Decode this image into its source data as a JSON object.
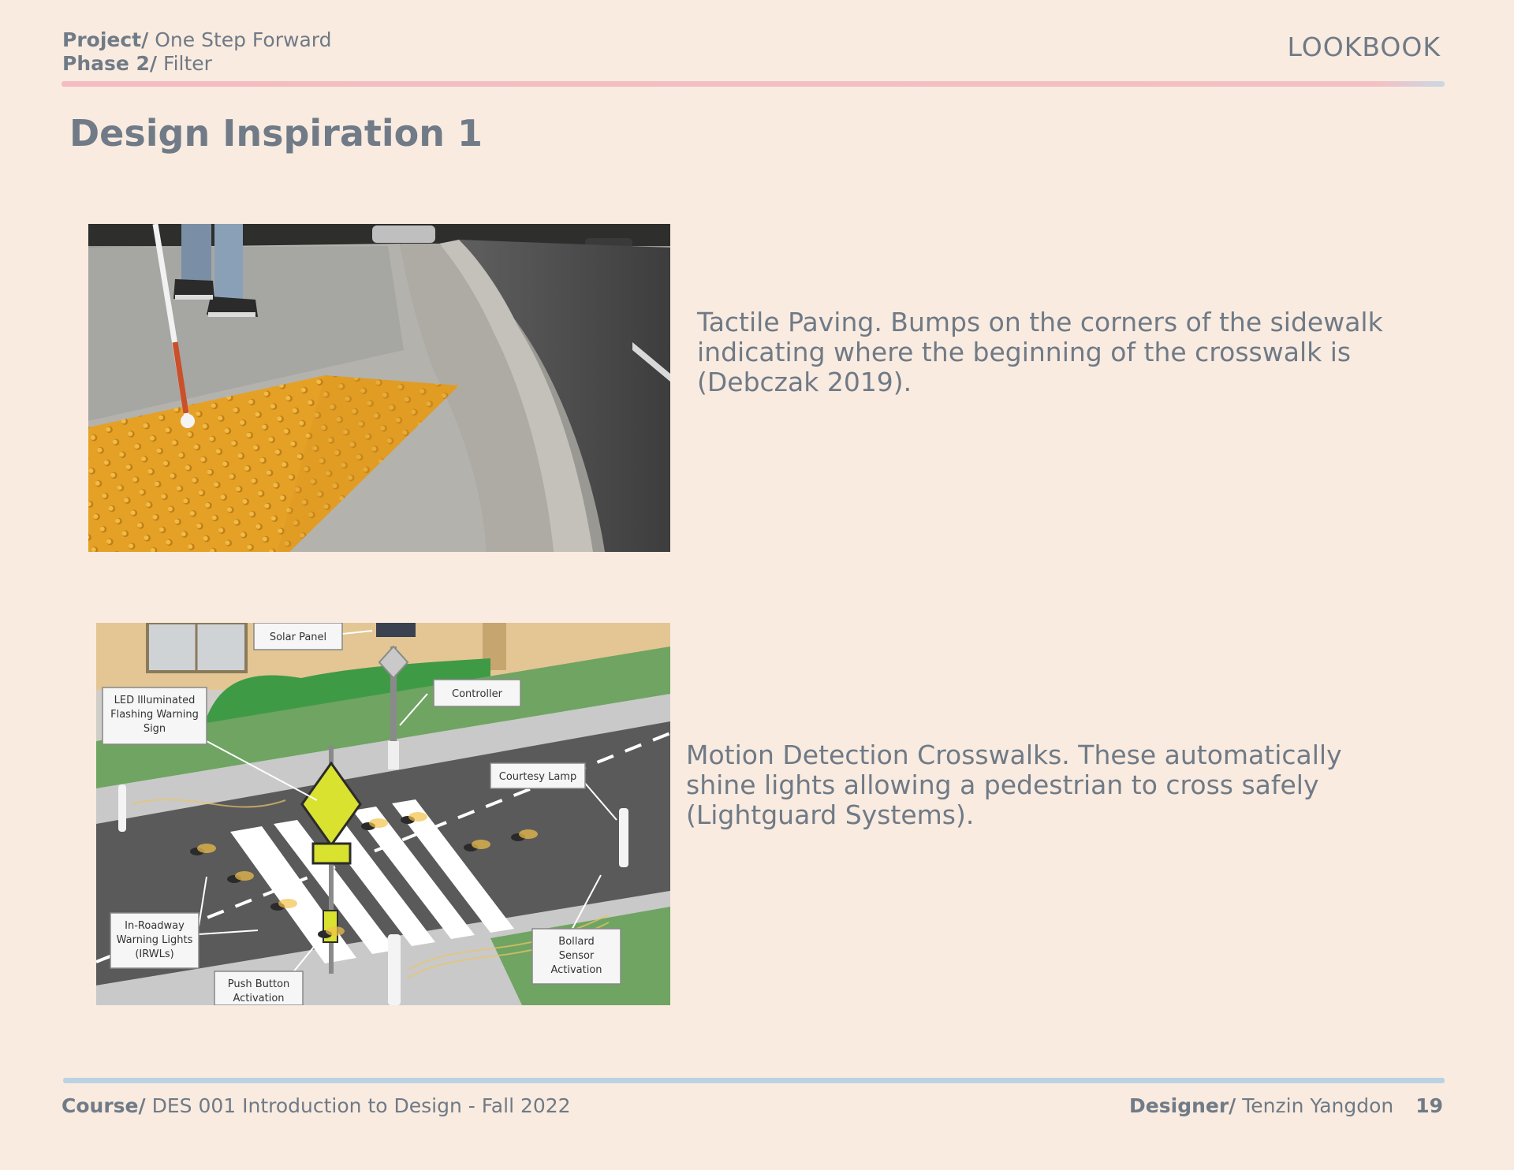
{
  "header": {
    "project_label": "Project/",
    "project_value": "One Step Forward",
    "phase_label": "Phase 2/",
    "phase_value": "Filter",
    "section": "LOOKBOOK"
  },
  "title": "Design Inspiration 1",
  "inspirations": [
    {
      "description": "Tactile Paving. Bumps on the corners of the sidewalk indicating where the beginning of the crosswalk is (Debczak 2019)."
    },
    {
      "description": "Motion Detection Crosswalks. These automatically shine lights allowing a pedestrian to cross safely (Lightguard Systems).",
      "diagram_labels": {
        "solar_panel": "Solar Panel",
        "controller": "Controller",
        "led_line1": "LED Illuminated",
        "led_line2": "Flashing Warning",
        "led_line3": "Sign",
        "courtesy_lamp": "Courtesy Lamp",
        "irwl_line1": "In-Roadway",
        "irwl_line2": "Warning Lights",
        "irwl_line3": "(IRWLs)",
        "push_line1": "Push Button",
        "push_line2": "Activation",
        "bollard_line1": "Bollard",
        "bollard_line2": "Sensor",
        "bollard_line3": "Activation"
      }
    }
  ],
  "footer": {
    "course_label": "Course/",
    "course_value": "DES 001 Introduction to Design - Fall 2022",
    "designer_label": "Designer/",
    "designer_value": "Tenzin Yangdon",
    "page_number": "19"
  },
  "colors": {
    "background": "#f9ebe0",
    "text": "#6f7a86",
    "top_rule": "#f4bcc0",
    "bottom_rule": "#b9d3e3",
    "paving_yellow": "#e9a72a"
  }
}
